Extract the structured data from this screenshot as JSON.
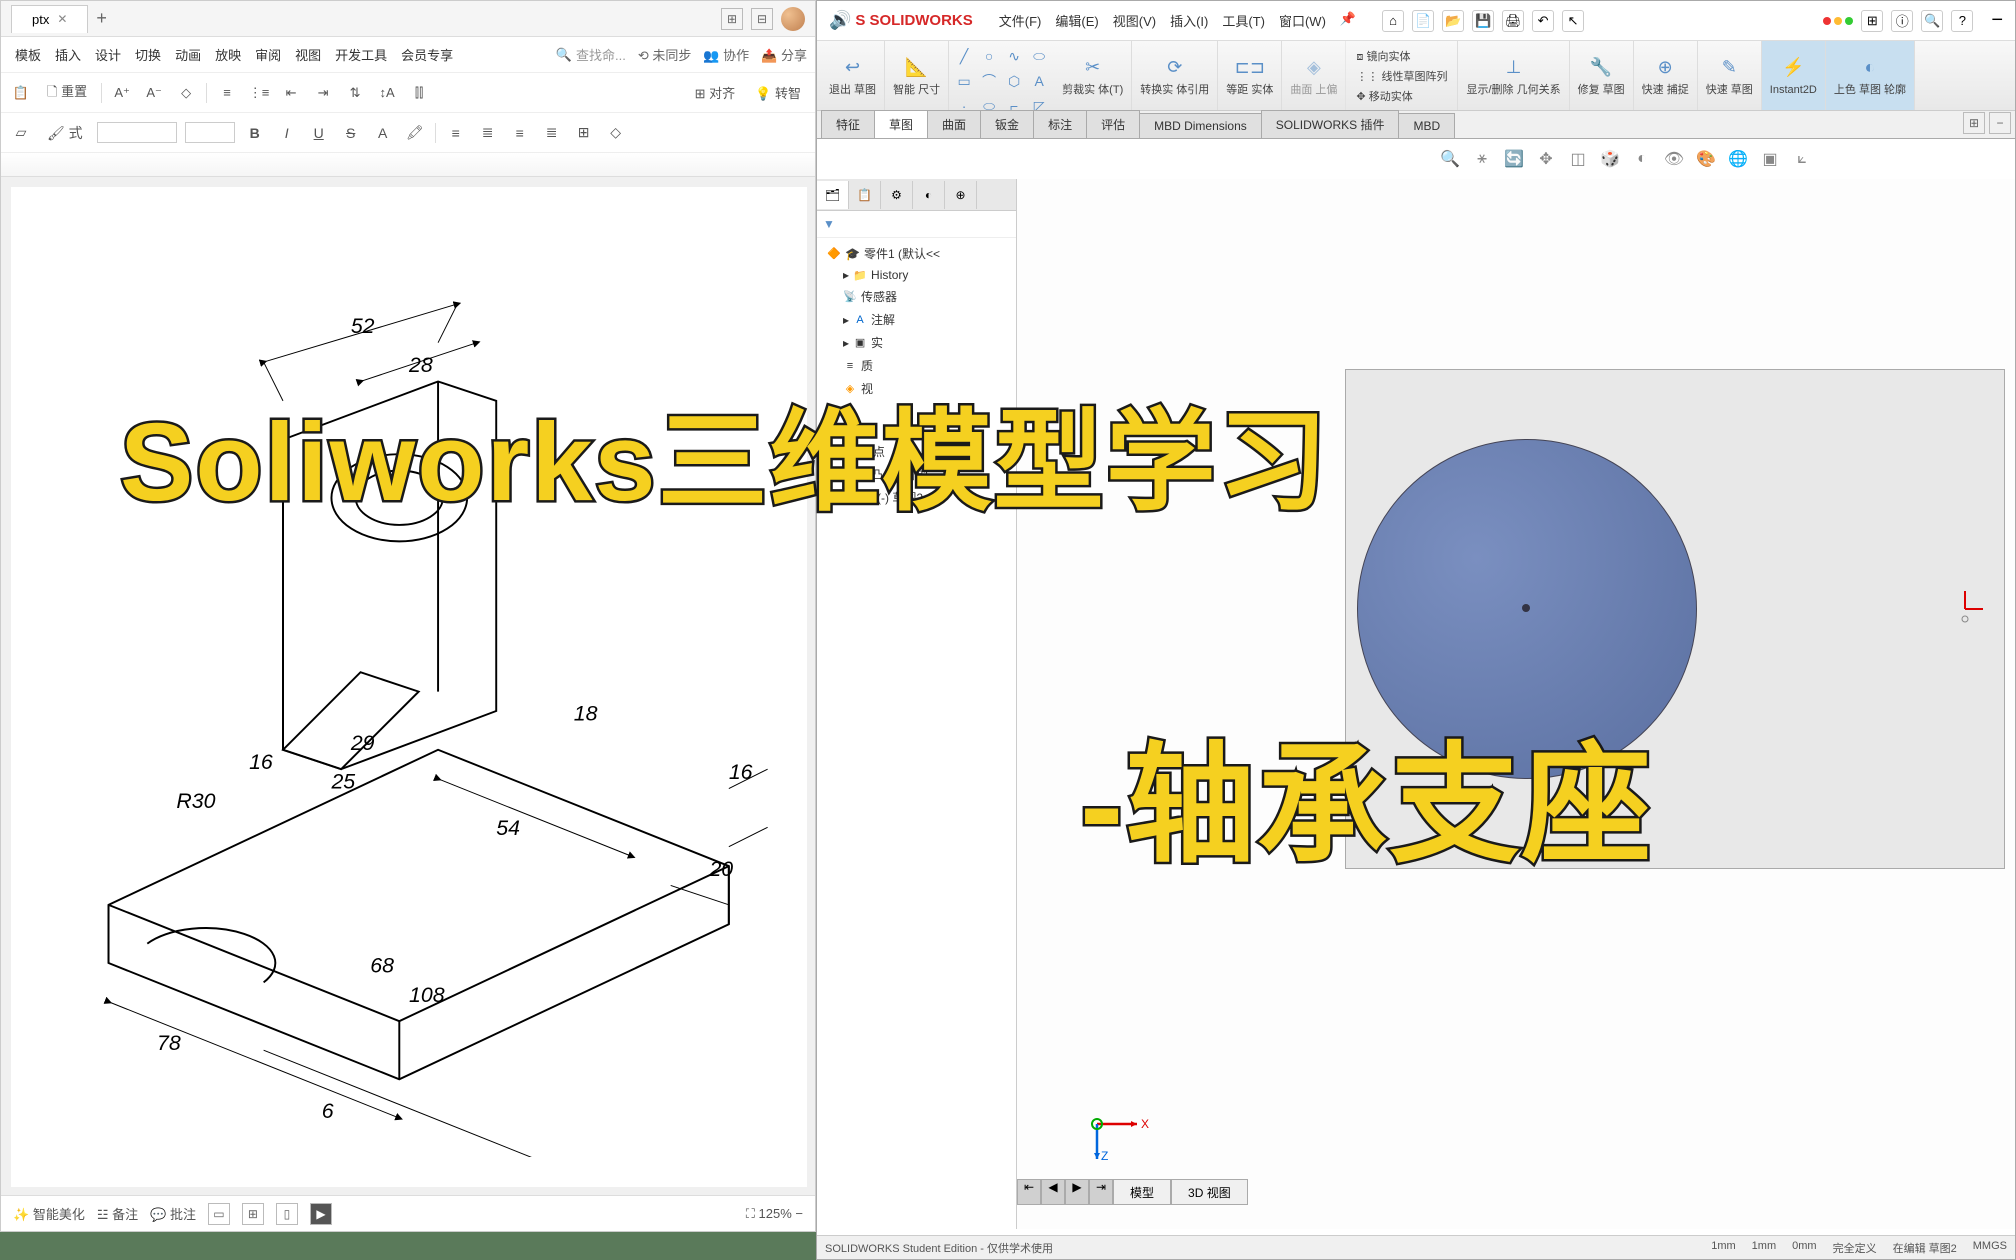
{
  "wps": {
    "tab_name": "ptx",
    "menus": [
      "模板",
      "插入",
      "设计",
      "切换",
      "动画",
      "放映",
      "审阅",
      "视图",
      "开发工具",
      "会员专享"
    ],
    "search_placeholder": "查找命...",
    "sync_label": "未同步",
    "collab_label": "协作",
    "share_label": "分享",
    "reset_label": "重置",
    "align_label": "对齐",
    "convert_label": "转智",
    "beautify": "智能美化",
    "notes": "备注",
    "comments": "批注",
    "zoom": "125%",
    "drawing_dims": {
      "d52": "52",
      "d28": "28",
      "d29": "29",
      "d18": "18",
      "d16a": "16",
      "d16b": "16",
      "d25": "25",
      "d54": "54",
      "d20": "20",
      "d68": "68",
      "d108": "108",
      "d78": "78",
      "d6": "6",
      "r30": "R30"
    }
  },
  "sw": {
    "brand": "SOLIDWORKS",
    "menus": [
      "文件(F)",
      "编辑(E)",
      "视图(V)",
      "插入(I)",
      "工具(T)",
      "窗口(W)"
    ],
    "ribbon": {
      "exit_sketch": "退出\n草图",
      "smart_dim": "智能\n尺寸",
      "trim": "剪裁实\n体(T)",
      "convert": "转换实\n体引用",
      "offset": "等距\n实体",
      "curve": "曲面\n上偏",
      "show_del": "显示/删除\n几何关系",
      "repair": "修复\n草图",
      "quick_snap": "快速\n捕捉",
      "quick_sketch": "快速\n草图",
      "instant2d": "Instant2D",
      "shade": "上色\n草图\n轮廓",
      "mirror": "镜向实体",
      "linear_pattern": "线性草图阵列",
      "move": "移动实体"
    },
    "tabs": [
      "特征",
      "草图",
      "曲面",
      "钣金",
      "标注",
      "评估",
      "MBD Dimensions",
      "SOLIDWORKS 插件",
      "MBD"
    ],
    "tree": {
      "root": "零件1 (默认<<",
      "history": "History",
      "sensors": "传感器",
      "annotations": "注解",
      "solid": "实",
      "material": "质",
      "front": "视",
      "origin_plane": "",
      "origin": "原点",
      "extrude": "凸台-拉伸1",
      "sketch2": "(-) 草图2"
    },
    "bottom_tabs": [
      "模型",
      "3D 视图"
    ],
    "status": {
      "edition": "SOLIDWORKS Student Edition - 仅供学术使用",
      "dim1": "1mm",
      "dim2": "1mm",
      "dim3": "0mm",
      "define": "完全定义",
      "editing": "在编辑 草图2",
      "units": "MMGS"
    },
    "axis": {
      "x": "X",
      "z": "Z"
    }
  },
  "overlay": {
    "main_title": "Soliworks三维模型学习",
    "sub_title": "-轴承支座"
  }
}
